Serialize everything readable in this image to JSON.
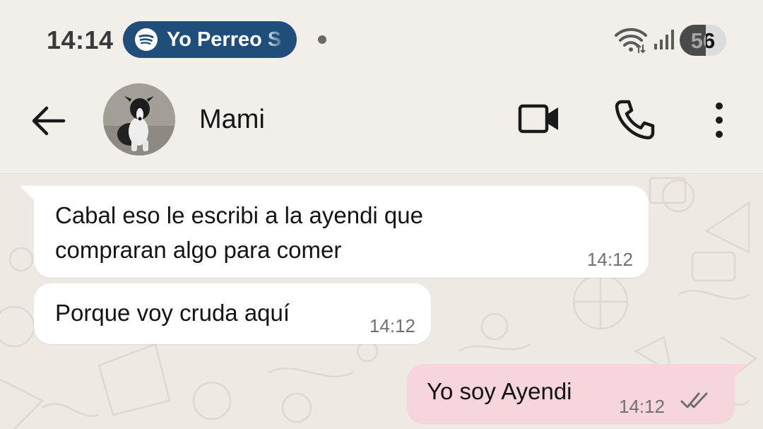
{
  "status_bar": {
    "time": "14:14",
    "media": {
      "app_icon": "spotify-icon",
      "title": "Yo Perreo S"
    },
    "notification_dot": "dot-icon",
    "wifi": "wifi-icon",
    "signal": "signal-icon",
    "battery": {
      "level": 56,
      "label": "56"
    }
  },
  "header": {
    "back_icon": "arrow-left-icon",
    "contact_name": "Mami",
    "avatar_alt": "puppy photo",
    "actions": [
      "video-call-icon",
      "phone-icon",
      "more-vertical-icon"
    ]
  },
  "messages": [
    {
      "direction": "incoming",
      "lines": [
        "Cabal eso le escribi a la ayendi que",
        "compraran algo para comer"
      ],
      "time": "14:12"
    },
    {
      "direction": "incoming",
      "lines": [
        "Porque voy cruda aquí"
      ],
      "time": "14:12"
    },
    {
      "direction": "outgoing",
      "lines": [
        "Yo soy Ayendi"
      ],
      "time": "14:12",
      "status": "delivered-double-check-icon"
    }
  ],
  "colors": {
    "status_bg": "#f2eeea",
    "chat_bg": "#efe9e3",
    "incoming_bubble": "#ffffff",
    "outgoing_bubble": "#f7d5dc",
    "media_pill": "#1f4e7a"
  }
}
